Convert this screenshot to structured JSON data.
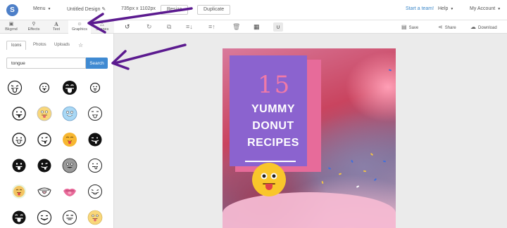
{
  "topbar": {
    "logo_letter": "S",
    "menu_label": "Menu",
    "design_title": "Untitled Design",
    "dimensions": "735px x 1102px",
    "resize_label": "Resize",
    "duplicate_label": "Duplicate",
    "start_team": "Start a team!",
    "help_label": "Help",
    "account_label": "My Account"
  },
  "tools": [
    {
      "label": "Bkgrnd",
      "icon": "image-icon"
    },
    {
      "label": "Effects",
      "icon": "wand-icon"
    },
    {
      "label": "Text",
      "icon": "text-icon"
    },
    {
      "label": "Graphics",
      "icon": "graphics-icon"
    },
    {
      "label": "Shapes",
      "icon": "shapes-icon"
    }
  ],
  "canvas_toolbar": {
    "save_label": "Save",
    "share_label": "Share",
    "download_label": "Download"
  },
  "panel": {
    "tabs": [
      "Icons",
      "Photos",
      "Uploads"
    ],
    "search_value": "tongue",
    "search_button": "Search"
  },
  "design": {
    "number": "15",
    "lines": [
      "YUMMY",
      "DONUT",
      "RECIPES"
    ]
  },
  "colors": {
    "accent": "#3f8ad2",
    "purple_card": "#8b63cf",
    "pink_block": "#e76b9a",
    "annotation_arrow": "#5b1a8f"
  }
}
